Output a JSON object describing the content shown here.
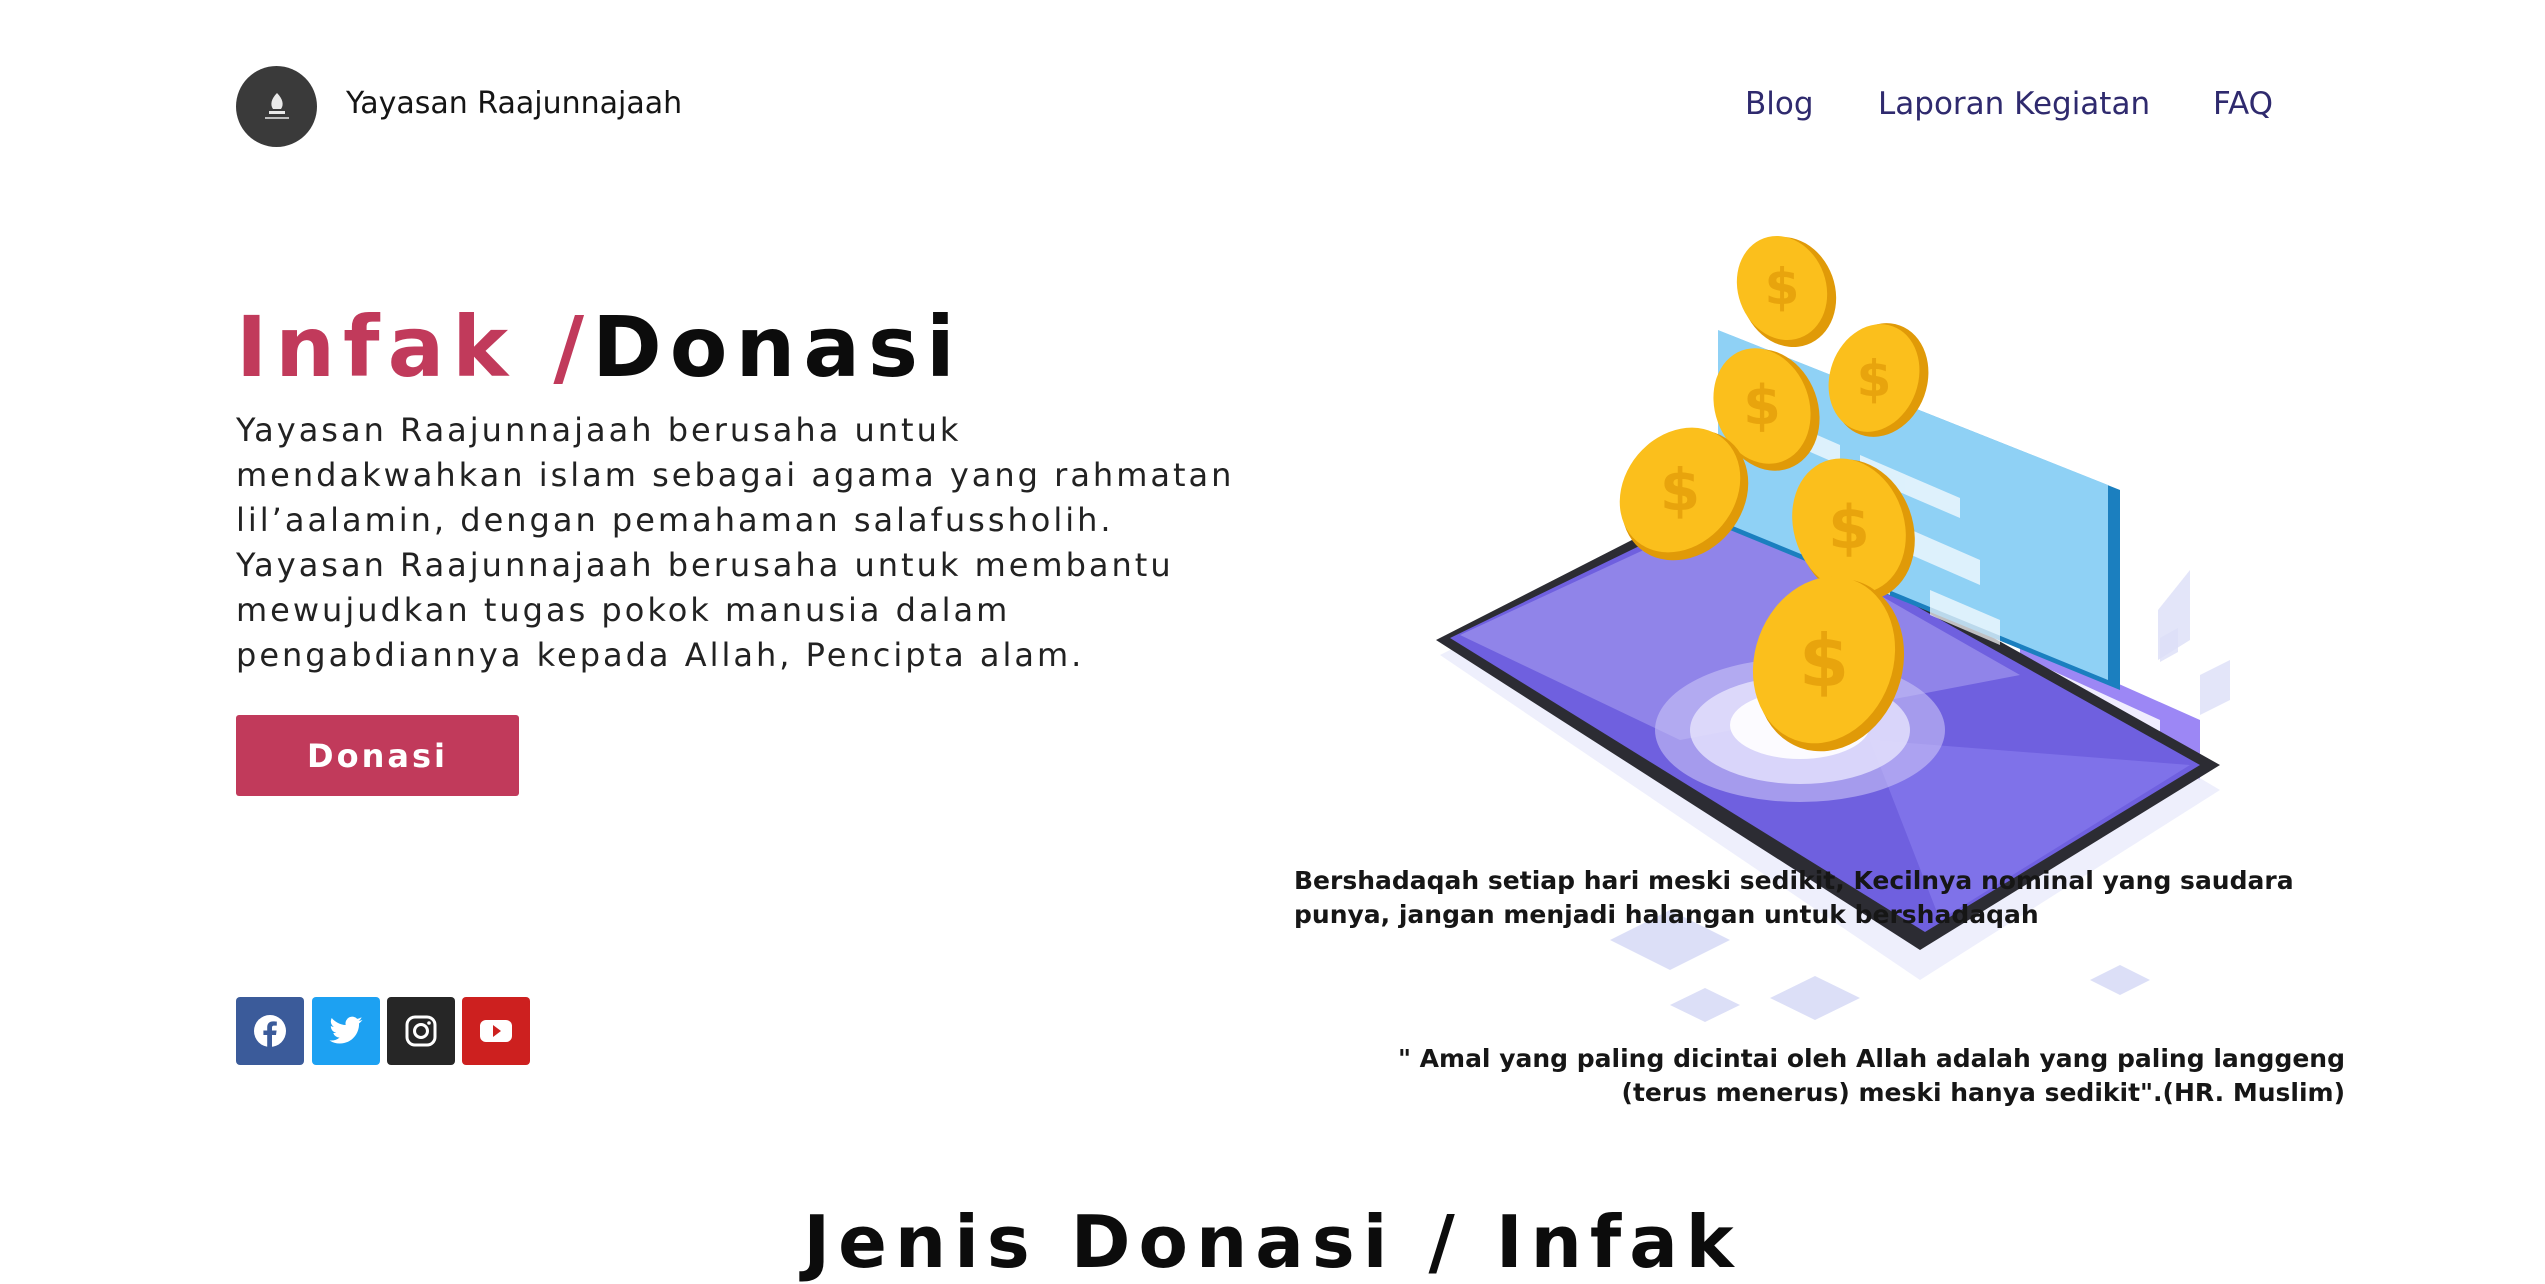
{
  "header": {
    "brand": "Yayasan Raajunnajaah",
    "nav": [
      "Blog",
      "Laporan Kegiatan",
      "FAQ"
    ]
  },
  "hero": {
    "title_part1": "Infak ",
    "title_slash": "/",
    "title_part2": "Donasi",
    "description": "Yayasan Raajunnajaah berusaha untuk mendakwahkan islam sebagai agama yang rahmatan lil’aalamin, dengan pemahaman salafussholih. Yayasan Raajunnajaah berusaha untuk membantu mewujudkan tugas pokok manusia dalam pengabdiannya kepada Allah, Pencipta alam.",
    "button_label": "Donasi"
  },
  "social": [
    "facebook-icon",
    "twitter-icon",
    "instagram-icon",
    "youtube-icon"
  ],
  "quotes": {
    "q1": "Bershadaqah setiap hari meski sedikit, Kecilnya nominal yang saudara punya, jangan menjadi halangan untuk bershadaqah",
    "q2": "\" Amal yang paling dicintai oleh Allah adalah yang paling langgeng (terus menerus) meski hanya sedikit\".(HR. Muslim)"
  },
  "section": {
    "title": "Jenis Donasi / Infak"
  },
  "colors": {
    "accent": "#c13a5b",
    "nav": "#2f2a6e",
    "facebook": "#3b5b9a",
    "twitter": "#1da1f2",
    "instagram": "#262626",
    "youtube": "#cd201f"
  }
}
